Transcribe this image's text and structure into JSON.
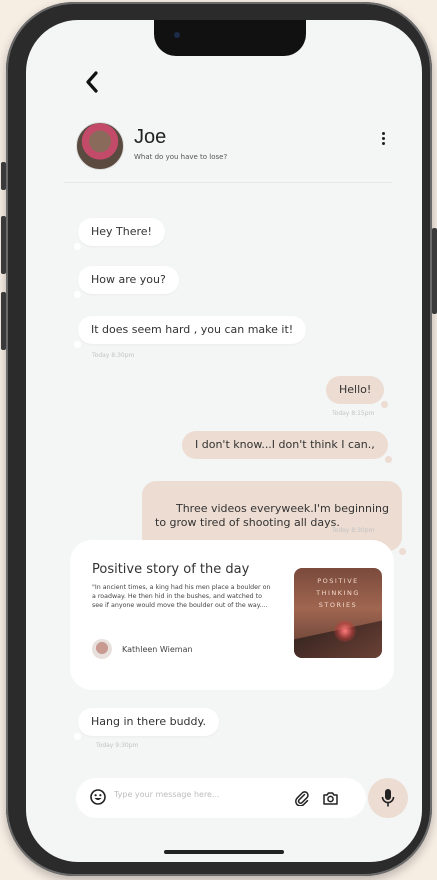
{
  "contact": {
    "name": "Joe",
    "status": "What do you have to lose?"
  },
  "messages": [
    {
      "direction": "in",
      "text": "Hey There!"
    },
    {
      "direction": "in",
      "text": "How are you?"
    },
    {
      "direction": "in",
      "text": "It does seem hard , you can make it!",
      "time": "Today 8:30pm"
    },
    {
      "direction": "out",
      "text": "Hello!",
      "time": "Today 8:15pm"
    },
    {
      "direction": "out",
      "text": "I don't know...I don't think I can.,"
    },
    {
      "direction": "out",
      "text": "Three videos everyweek.I'm beginning\nto grow tired of shooting all days.",
      "time": "Today 8:30pm"
    },
    {
      "direction": "in",
      "text": "Hang in there buddy.",
      "time": "Today 9:30pm"
    }
  ],
  "story": {
    "title": "Positive story of the day",
    "text": "\"In ancient times, a king had his men place a boulder on a roadway. He then hid in the bushes, and watched to see if anyone would move the boulder out of the way....",
    "author": "Kathleen Wieman",
    "image_caption": [
      "POSITIVE",
      "THINKING",
      "STORIES"
    ]
  },
  "composer": {
    "placeholder": "Type your message here..."
  },
  "icons": {
    "back": "chevron-left-icon",
    "menu": "more-vertical-icon",
    "emoji": "emoji-icon",
    "attach": "paperclip-icon",
    "camera": "camera-icon",
    "mic": "microphone-icon"
  },
  "colors": {
    "background": "#f6ede3",
    "screen": "#f4f5f5",
    "outgoing_bubble": "#ecdcd2",
    "incoming_bubble": "#ffffff"
  }
}
